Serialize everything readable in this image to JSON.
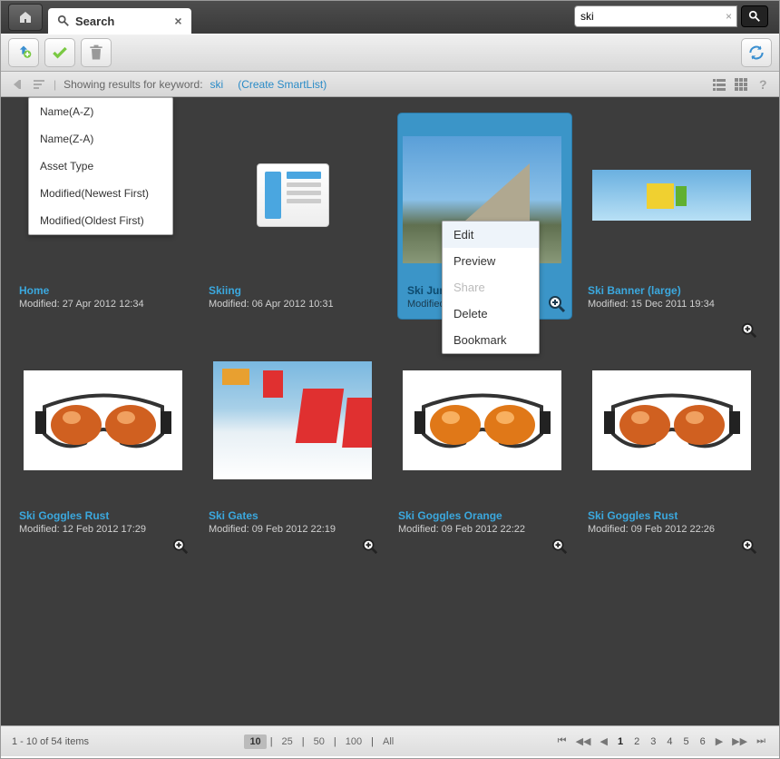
{
  "tab": {
    "label": "Search",
    "close": "×"
  },
  "search": {
    "value": "ski",
    "clear": "×"
  },
  "filter": {
    "label": "Showing results for keyword:",
    "keyword": "ski",
    "create_link": "(Create SmartList)"
  },
  "sort_menu": [
    "Name(A-Z)",
    "Name(Z-A)",
    "Asset Type",
    "Modified(Newest First)",
    "Modified(Oldest First)"
  ],
  "ctx_menu": [
    {
      "label": "Edit",
      "disabled": false,
      "hl": true
    },
    {
      "label": "Preview",
      "disabled": false
    },
    {
      "label": "Share",
      "disabled": true
    },
    {
      "label": "Delete",
      "disabled": false
    },
    {
      "label": "Bookmark",
      "disabled": false
    }
  ],
  "cards": [
    {
      "title": "Home",
      "modified": "Modified: 27 Apr 2012 12:34",
      "type": "doc"
    },
    {
      "title": "Skiing",
      "modified": "Modified: 06 Apr 2012 10:31",
      "type": "doc"
    },
    {
      "title": "Ski Jump",
      "modified": "Modified:",
      "type": "jump",
      "selected": true
    },
    {
      "title": "Ski Banner (large)",
      "modified": "Modified: 15 Dec 2011 19:34",
      "type": "banner"
    },
    {
      "title": "Ski Goggles Rust",
      "modified": "Modified: 12 Feb 2012 17:29",
      "type": "goggles"
    },
    {
      "title": "Ski Gates",
      "modified": "Modified: 09 Feb 2012 22:19",
      "type": "gates"
    },
    {
      "title": "Ski Goggles Orange",
      "modified": "Modified: 09 Feb 2012 22:22",
      "type": "goggles"
    },
    {
      "title": "Ski Goggles Rust",
      "modified": "Modified: 09 Feb 2012 22:26",
      "type": "goggles"
    }
  ],
  "footer": {
    "status": "1 - 10 of 54 items",
    "sizes": [
      "10",
      "25",
      "50",
      "100",
      "All"
    ],
    "active_size": "10",
    "pages": [
      "1",
      "2",
      "3",
      "4",
      "5",
      "6"
    ],
    "active_page": "1"
  }
}
